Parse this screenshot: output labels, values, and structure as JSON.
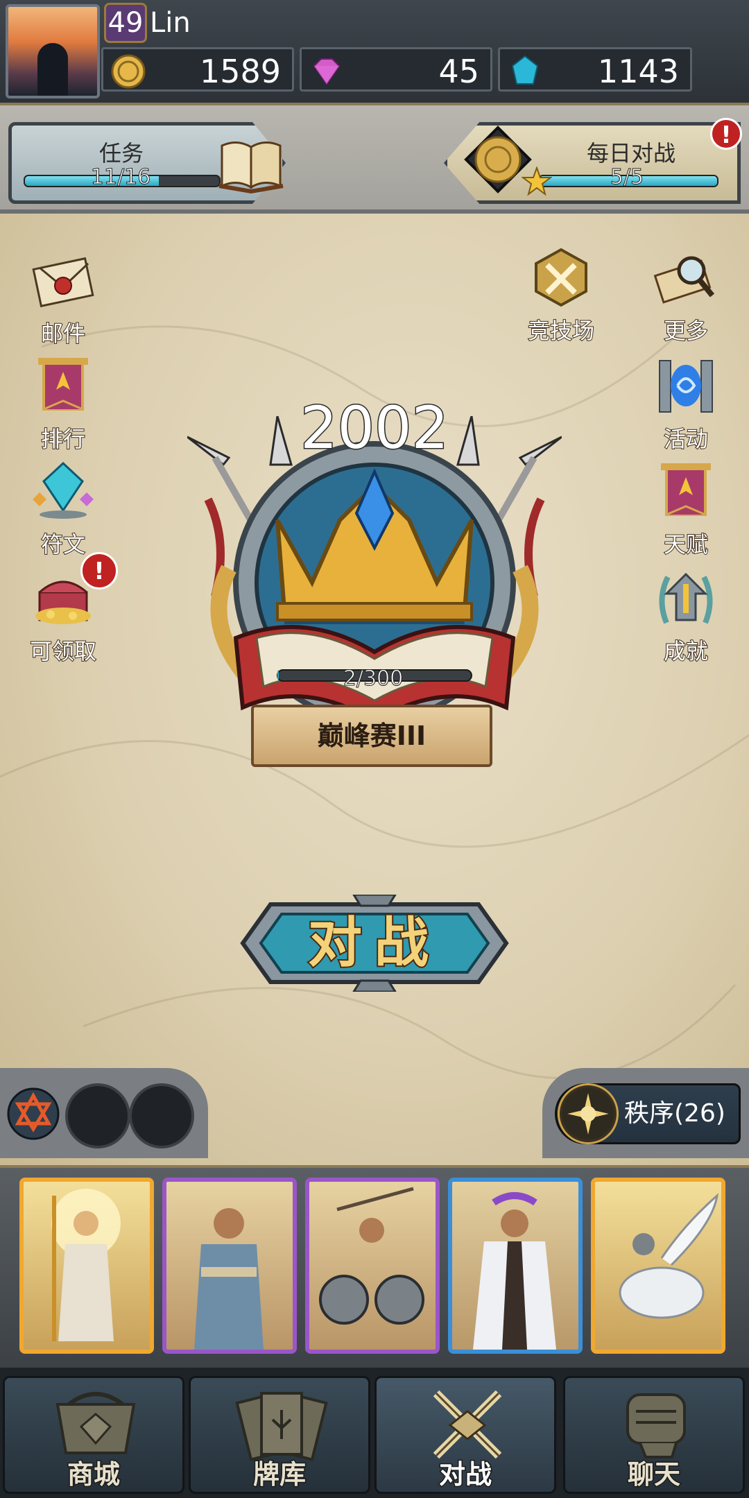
{
  "player": {
    "level": "49",
    "name": "Lin"
  },
  "currencies": {
    "gold": "1589",
    "gem": "45",
    "shard": "1143"
  },
  "quest": {
    "title": "任务",
    "progress_text": "11/16",
    "progress": 0.6875
  },
  "daily_battle": {
    "title": "每日对战",
    "progress_text": "5/5",
    "progress": 1.0,
    "badge": "!"
  },
  "left_menu": [
    {
      "label": "邮件",
      "icon": "mail-icon"
    },
    {
      "label": "排行",
      "icon": "ranking-banner-icon"
    },
    {
      "label": "符文",
      "icon": "rune-crystal-icon"
    },
    {
      "label": "可领取",
      "icon": "treasure-chest-icon",
      "badge": "!"
    }
  ],
  "right_menu": [
    {
      "label": "竞技场",
      "icon": "crossed-swords-icon"
    },
    {
      "label": "更多",
      "icon": "magnifier-scroll-icon"
    },
    {
      "label": "活动",
      "icon": "portal-icon"
    },
    {
      "label": "天赋",
      "icon": "talent-banner-icon"
    },
    {
      "label": "成就",
      "icon": "achievement-laurel-icon"
    }
  ],
  "rank": {
    "score": "2002",
    "progress_text": "2/300",
    "progress": 0.0067,
    "tier": "巅峰赛III"
  },
  "battle_button": {
    "label": "对战"
  },
  "faction": {
    "label": "秩序(26)",
    "icon": "sun-emblem-icon"
  },
  "cards": [
    {
      "rarity": "gold",
      "subject": "sun-god-card"
    },
    {
      "rarity": "purple",
      "subject": "warrior-card"
    },
    {
      "rarity": "purple",
      "subject": "chariot-card"
    },
    {
      "rarity": "blue",
      "subject": "priest-card"
    },
    {
      "rarity": "gold",
      "subject": "pegasus-rider-card"
    }
  ],
  "nav": [
    {
      "label": "商城",
      "icon": "shop-icon",
      "active": false
    },
    {
      "label": "牌库",
      "icon": "card-deck-icon",
      "active": false
    },
    {
      "label": "对战",
      "icon": "battle-swords-icon",
      "active": true
    },
    {
      "label": "聊天",
      "icon": "chat-fist-icon",
      "active": false
    }
  ],
  "colors": {
    "accent_teal": "#2da7c1",
    "gold": "#f0a830",
    "notification_red": "#c02222"
  }
}
